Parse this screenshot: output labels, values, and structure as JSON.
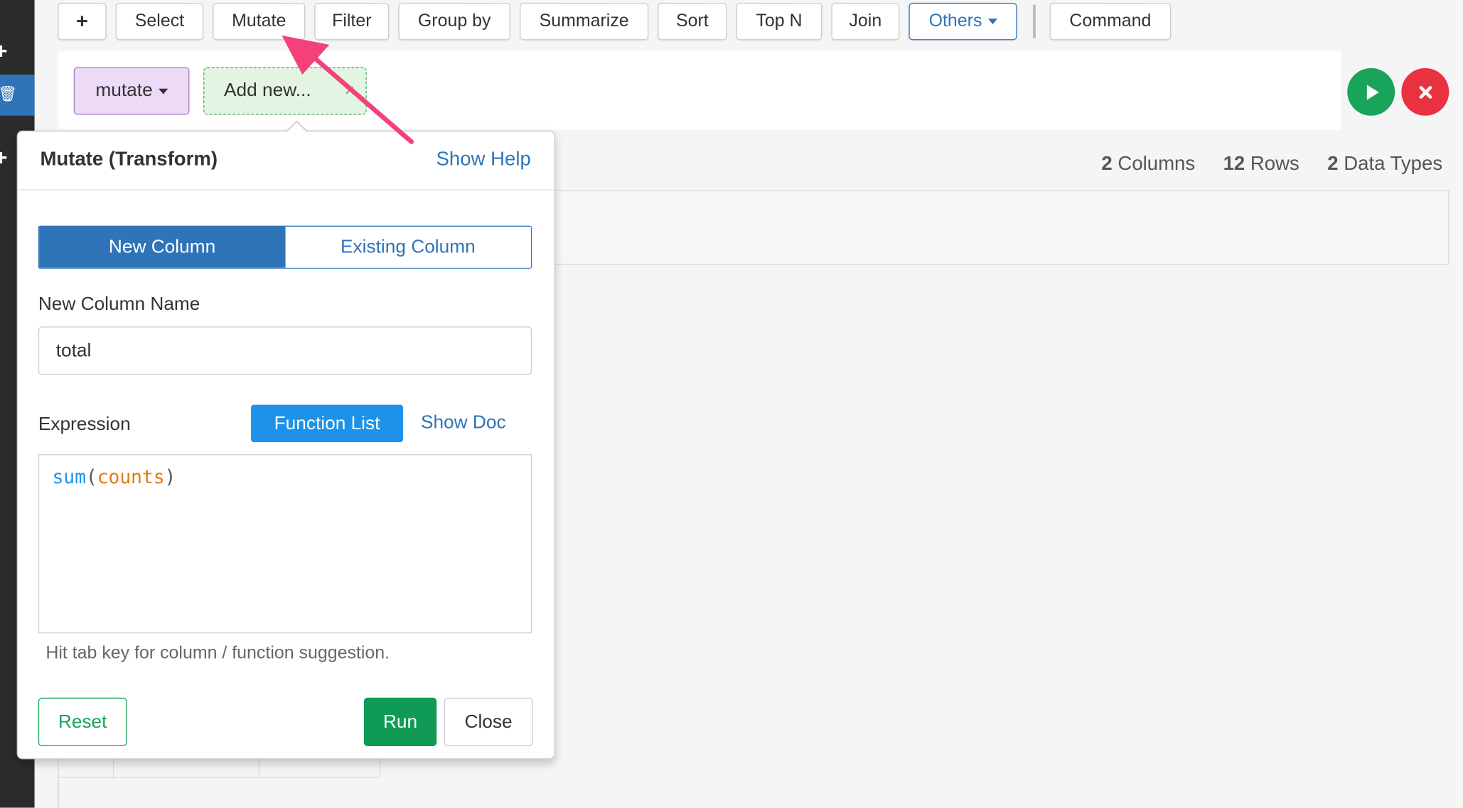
{
  "toolbar": {
    "plus_label": "+",
    "buttons": [
      "Select",
      "Mutate",
      "Filter",
      "Group by",
      "Summarize",
      "Sort",
      "Top N",
      "Join"
    ],
    "others_label": "Others",
    "command_label": "Command"
  },
  "pipeline": {
    "step_label": "mutate",
    "add_new_label": "Add new...",
    "remove_glyph": "×"
  },
  "stats": {
    "columns_count": "2",
    "columns_label": "Columns",
    "rows_count": "12",
    "rows_label": "Rows",
    "types_count": "2",
    "types_label": "Data Types"
  },
  "popover": {
    "title": "Mutate (Transform)",
    "show_help": "Show Help",
    "tab_new": "New Column",
    "tab_existing": "Existing Column",
    "name_label": "New Column Name",
    "name_value": "total",
    "expression_label": "Expression",
    "function_list": "Function List",
    "show_doc": "Show Doc",
    "expression": {
      "fn": "sum",
      "open": "(",
      "arg": "counts",
      "close": ")"
    },
    "hint": "Hit tab key for column / function suggestion.",
    "reset": "Reset",
    "run": "Run",
    "close": "Close"
  },
  "colors": {
    "primary_blue": "#2f74b8",
    "green": "#19a45b",
    "red": "#e8323f",
    "annotation_pink": "#f4417a"
  },
  "icons": [
    "plus-icon",
    "trash-icon",
    "caret-down-icon",
    "play-icon",
    "close-icon",
    "annotation-arrow"
  ]
}
